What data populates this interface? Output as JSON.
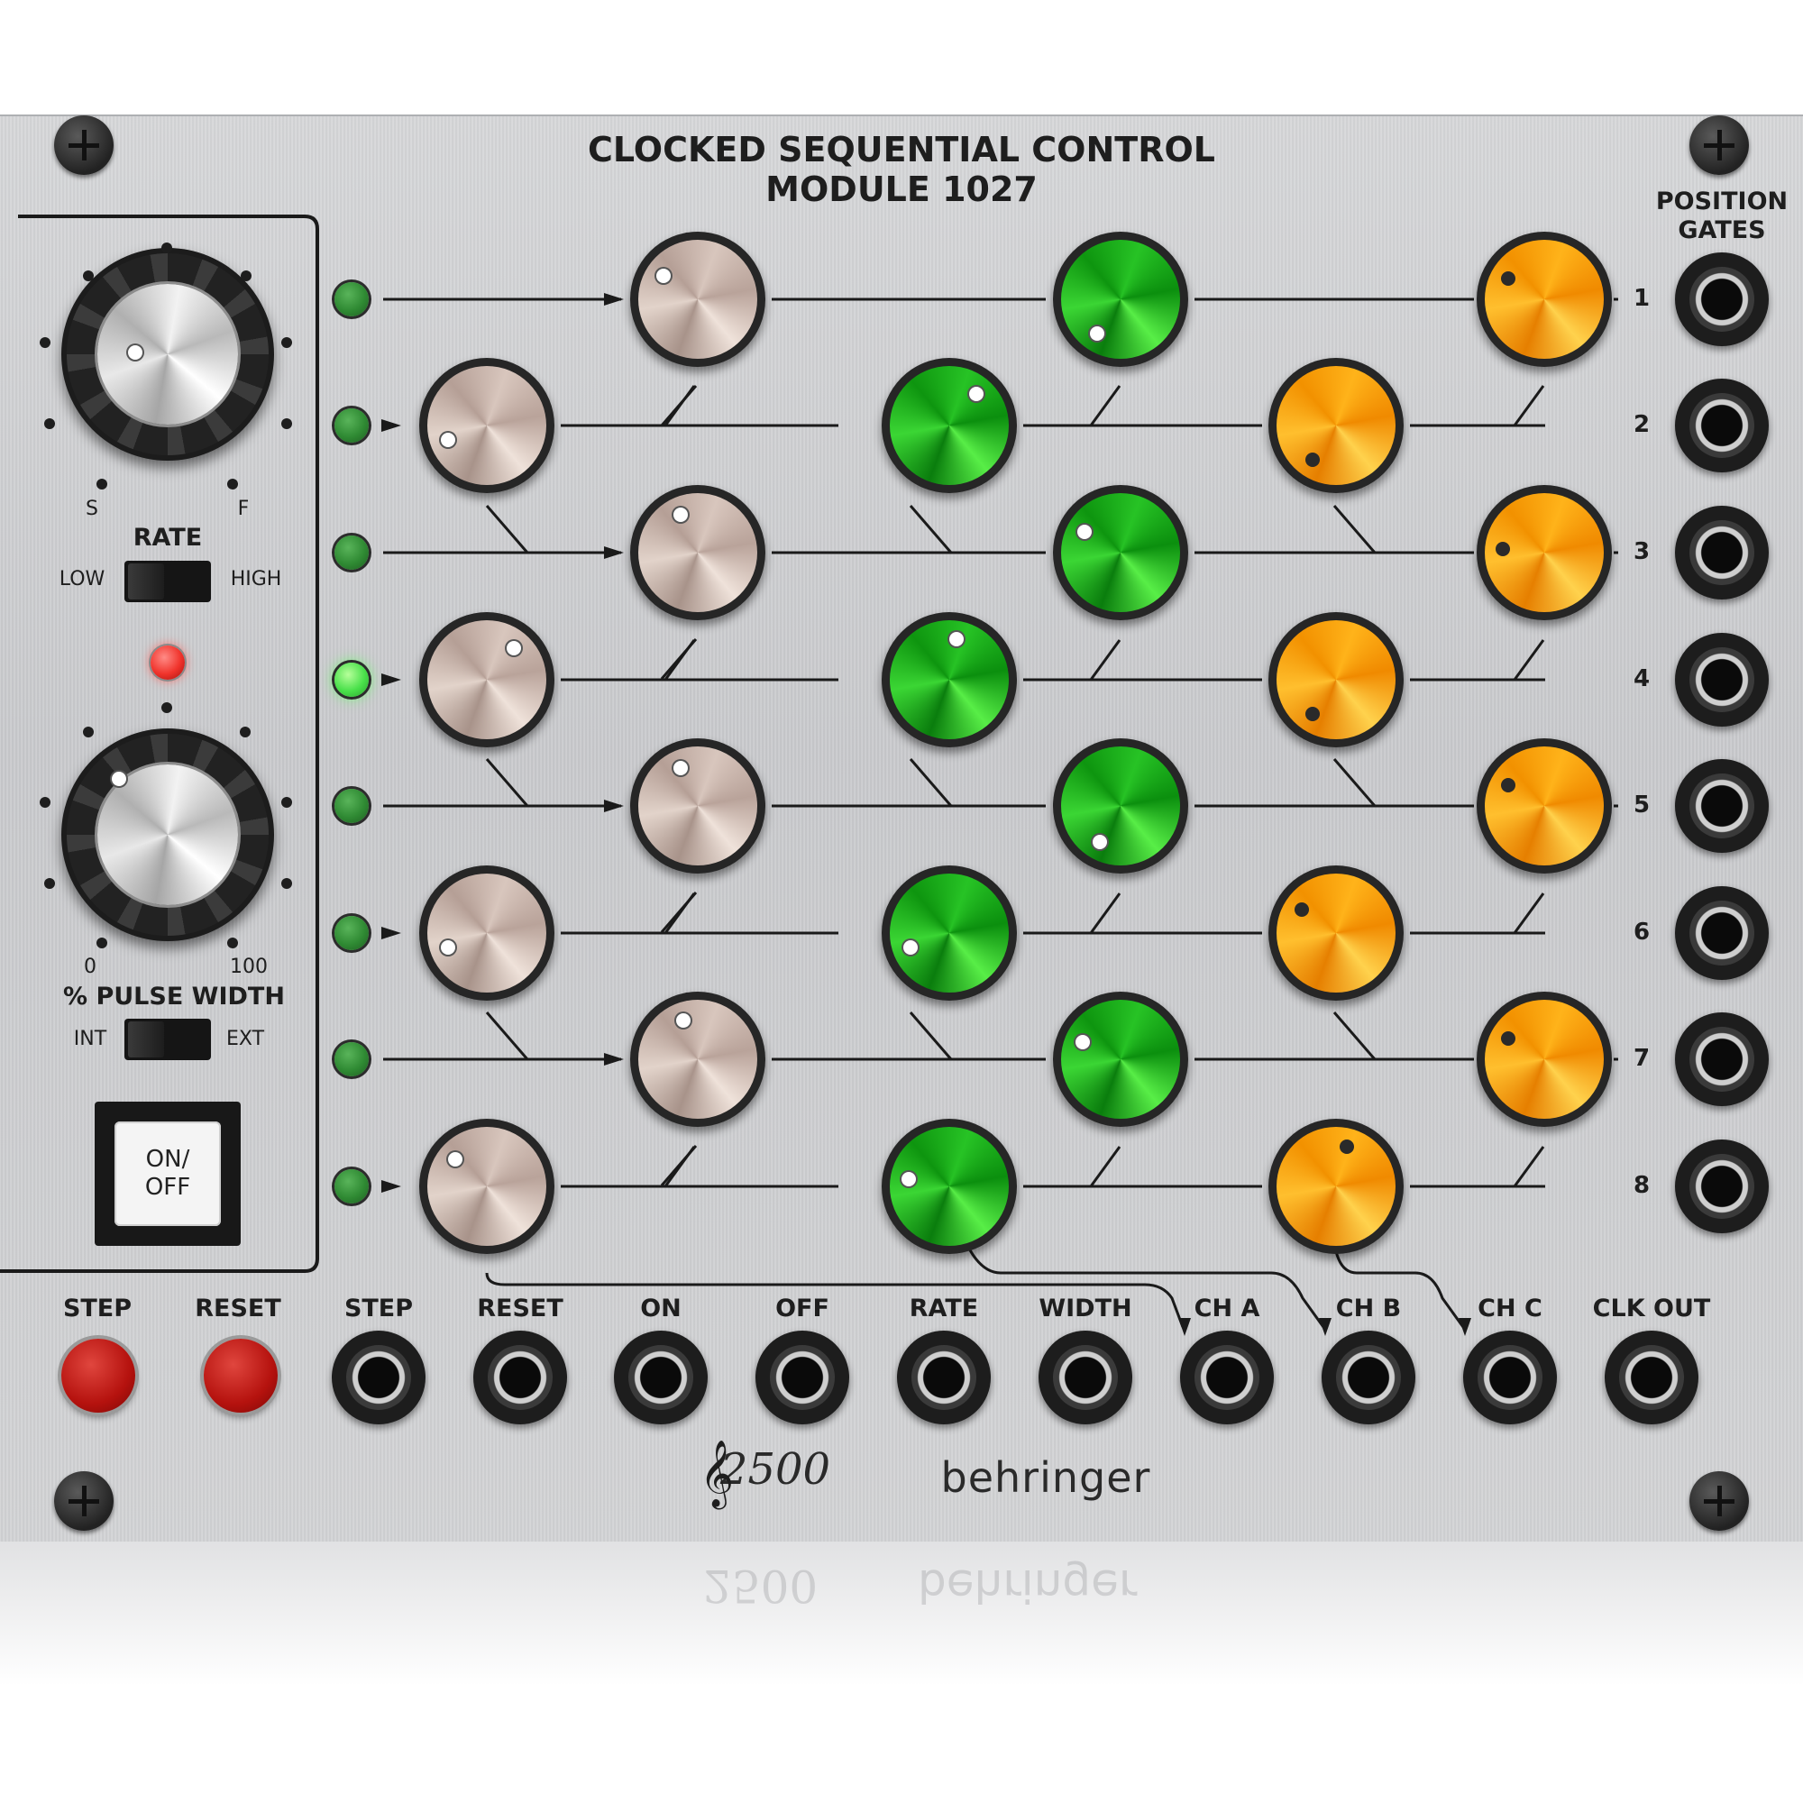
{
  "title": {
    "line1": "CLOCKED SEQUENTIAL CONTROL",
    "line2": "MODULE 1027"
  },
  "position_gates": {
    "header_line1": "POSITION",
    "header_line2": "GATES",
    "numbers": [
      "1",
      "2",
      "3",
      "4",
      "5",
      "6",
      "7",
      "8"
    ]
  },
  "rate": {
    "label": "RATE",
    "scale_left": "S",
    "scale_right": "F",
    "switch_left": "LOW",
    "switch_right": "HIGH"
  },
  "pulse_width": {
    "label": "% PULSE WIDTH",
    "scale_left": "0",
    "scale_right": "100",
    "switch_left": "INT",
    "switch_right": "EXT"
  },
  "power_button": {
    "label": "ON/\nOFF"
  },
  "buttons": {
    "step": "STEP",
    "reset": "RESET"
  },
  "jacks": [
    "STEP",
    "RESET",
    "ON",
    "OFF",
    "RATE",
    "WIDTH",
    "CH A",
    "CH B",
    "CH C",
    "CLK OUT"
  ],
  "logo": {
    "series": "2500",
    "brand": "behringer"
  },
  "colors": {
    "channel_a_knob": "#d8c6bd",
    "channel_b_knob": "#27c325",
    "channel_c_knob": "#ffb31a",
    "active_led": "#49e04a",
    "clock_led": "#f0332b"
  },
  "stage_leds": [
    false,
    false,
    false,
    true,
    false,
    false,
    false,
    false
  ]
}
